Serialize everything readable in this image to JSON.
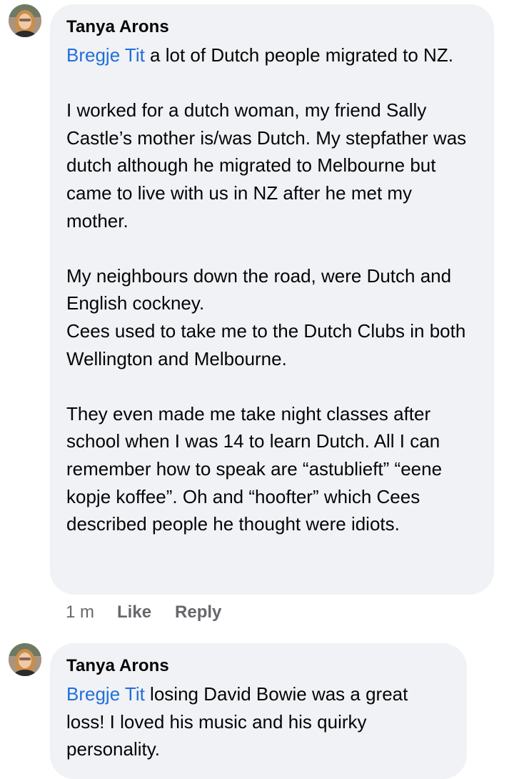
{
  "comments": [
    {
      "author": "Tanya Arons",
      "mention": "Bregje Tit",
      "paragraphs": [
        {
          "mention_lead": true,
          "text": " a lot of Dutch people migrated to NZ."
        },
        {
          "gap": true,
          "text": "I worked for a dutch woman, my friend Sally Castle’s  mother  is/was Dutch.  My stepfather was dutch although he migrated to Melbourne but came to live with us in NZ after he met my mother."
        },
        {
          "gap": true,
          "text": "My neighbours  down the road, were Dutch and English cockney."
        },
        {
          "gap": false,
          "text": "Cees used to take me to the Dutch  Clubs in both Wellington and Melbourne."
        },
        {
          "gap": true,
          "text": "They even made me take night classes after school when I was 14 to learn Dutch.  All I can remember how to speak are “astublieft” “eene kopje koffee”.  Oh and “hoofter” which Cees described people he thought were idiots."
        }
      ],
      "actions": {
        "time": "1 m",
        "like": "Like",
        "reply": "Reply"
      }
    },
    {
      "author": "Tanya Arons",
      "mention": "Bregje Tit",
      "text": " losing David Bowie was a great loss! I loved his music and his quirky personality."
    }
  ],
  "colors": {
    "bubble": "#f0f2f5",
    "mention": "#216fdb",
    "meta": "#65676b"
  }
}
